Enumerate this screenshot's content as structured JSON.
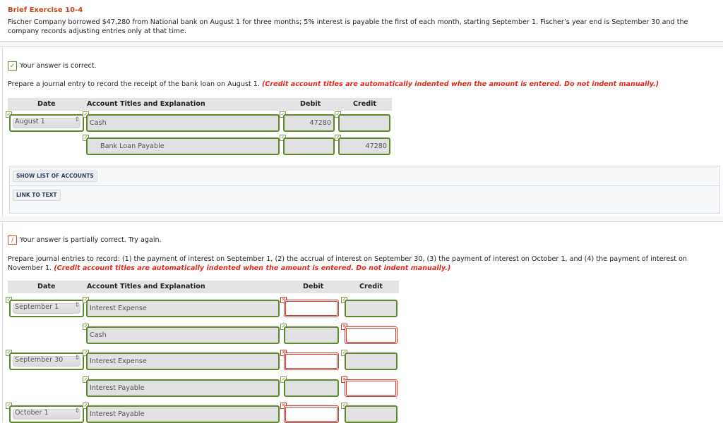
{
  "exercise": {
    "title": "Brief Exercise 10-4",
    "text": "Fischer Company borrowed $47,280 from National bank on August 1 for three months; 5% interest is payable the first of each month, starting September 1. Fischer’s year end is September 30 and the company records adjusting entries only at that time."
  },
  "part1": {
    "status": "Your answer is correct.",
    "status_icon": "check-icon",
    "instruction": "Prepare a journal entry to record the receipt of the bank loan on August 1.",
    "note": "(Credit account titles are automatically indented when the amount is entered. Do not indent manually.)",
    "headers": {
      "date": "Date",
      "account": "Account Titles and Explanation",
      "debit": "Debit",
      "credit": "Credit"
    },
    "rows": [
      {
        "date": "August 1",
        "account": "Cash",
        "debit": "47280",
        "credit": ""
      },
      {
        "date": "",
        "account": "Bank Loan Payable",
        "debit": "",
        "credit": "47280"
      }
    ],
    "buttons": {
      "show_accounts": "SHOW LIST OF ACCOUNTS",
      "link_text": "LINK TO TEXT"
    }
  },
  "part2": {
    "status": "Your answer is partially correct.  Try again.",
    "status_icon": "pencil-icon",
    "instruction": "Prepare journal entries to record: (1) the payment of interest on September 1, (2) the accrual of interest on September 30, (3) the payment of interest on October 1, and (4) the payment of interest on November 1.",
    "note": "(Credit account titles are automatically indented when the amount is entered. Do not indent manually.)",
    "headers": {
      "date": "Date",
      "account": "Account Titles and Explanation",
      "debit": "Debit",
      "credit": "Credit"
    },
    "rows": [
      {
        "date": "September 1",
        "account": "Interest Expense",
        "debit": "",
        "credit": "",
        "debit_ok": false,
        "credit_ok": true
      },
      {
        "date": "",
        "account": "Cash",
        "debit": "",
        "credit": "",
        "debit_ok": true,
        "credit_ok": false
      },
      {
        "date": "September 30",
        "account": "Interest Expense",
        "debit": "",
        "credit": "",
        "debit_ok": false,
        "credit_ok": true
      },
      {
        "date": "",
        "account": "Interest Payable",
        "debit": "",
        "credit": "",
        "debit_ok": true,
        "credit_ok": false
      },
      {
        "date": "October 1",
        "account": "Interest Payable",
        "debit": "",
        "credit": "",
        "debit_ok": false,
        "credit_ok": true
      }
    ]
  },
  "marks": {
    "ok": "✓",
    "bad": "✕"
  },
  "colors": {
    "title": "#c4451c",
    "note": "#e0281e",
    "ok_border": "#5e8a2b",
    "bad_border": "#d43a2e"
  }
}
